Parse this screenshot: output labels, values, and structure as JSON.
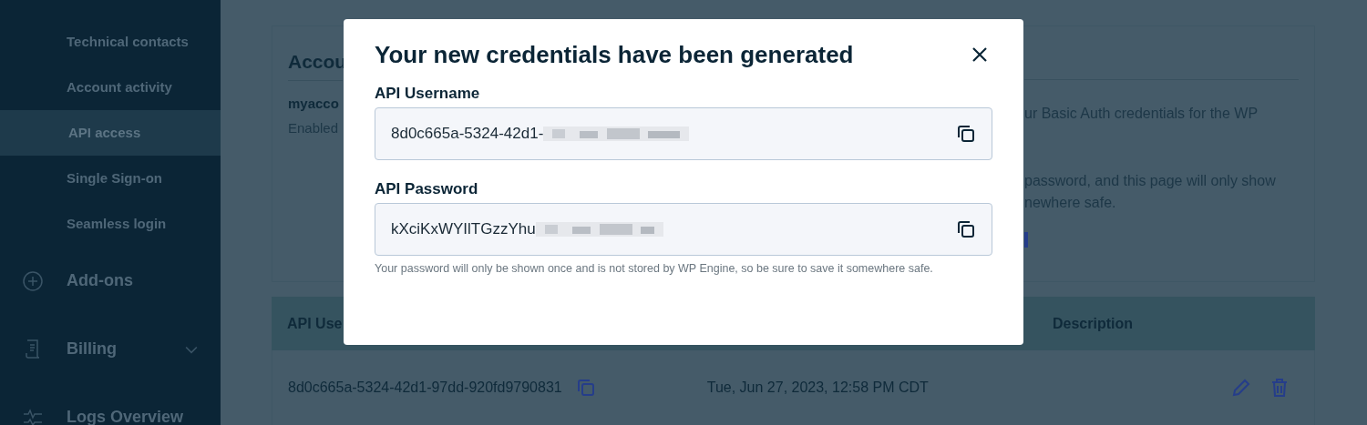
{
  "sidebar": {
    "items": [
      {
        "label": "Technical contacts",
        "kind": "subitem",
        "selected": false
      },
      {
        "label": "Account activity",
        "kind": "subitem",
        "selected": false
      },
      {
        "label": "API access",
        "kind": "subitem",
        "selected": true
      },
      {
        "label": "Single Sign-on",
        "kind": "subitem",
        "selected": false
      },
      {
        "label": "Seamless login",
        "kind": "subitem",
        "selected": false
      },
      {
        "label": "Add-ons",
        "kind": "section"
      },
      {
        "label": "Billing",
        "kind": "section",
        "expanded": false
      },
      {
        "label": "Logs Overview",
        "kind": "section"
      }
    ]
  },
  "card": {
    "title": "Accou",
    "account_name": "myacco",
    "account_status": "Enabled",
    "description_lines": [
      "ur Basic Auth credentials for the WP",
      "password, and this page will only show",
      "newhere safe."
    ]
  },
  "table": {
    "columns": [
      "API Use",
      "Description"
    ],
    "rows": [
      {
        "username": "8d0c665a-5324-42d1-97dd-920fd9790831",
        "created": "Tue, Jun 27, 2023, 12:58 PM CDT"
      }
    ]
  },
  "dialog": {
    "title": "Your new credentials have been generated",
    "fields": [
      {
        "label": "API Username",
        "value": "8d0c665a-5324-42d1-"
      },
      {
        "label": "API Password",
        "value": "kXciKxWYIlTGzzYhu"
      }
    ],
    "hint": "Your password will only be shown once and is not stored by WP Engine, so be sure to save it somewhere safe."
  }
}
